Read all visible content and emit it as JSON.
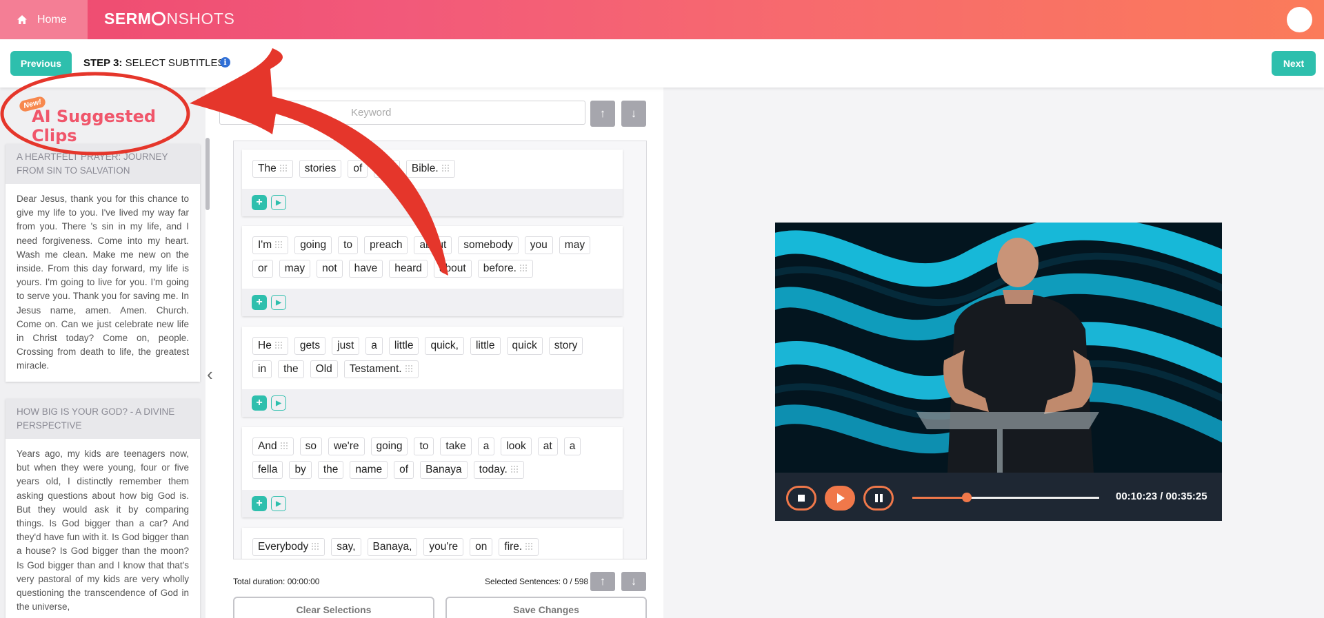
{
  "header": {
    "home_label": "Home",
    "logo_text_left": "SERM",
    "logo_text_right": "NSHOTS"
  },
  "stepbar": {
    "previous_label": "Previous",
    "next_label": "Next",
    "step_prefix": "STEP 3:",
    "step_title": "SELECT SUBTITLES",
    "info_glyph": "i"
  },
  "ai_panel": {
    "badge": "New!",
    "title": "AI Suggested Clips",
    "clips": [
      {
        "title": "A HEARTFELT PRAYER: JOURNEY FROM SIN TO SALVATION",
        "body": "Dear Jesus, thank you for this chance to give my life to you. I've lived my way far from you. There 's sin in my life, and I need forgiveness. Come into my heart. Wash me clean. Make me new on the inside. From this day forward, my life is yours. I'm going to live for you. I'm going to serve you. Thank you for saving me. In Jesus name, amen. Amen. Church. Come on. Can we just celebrate new life in Christ today? Come on, people. Crossing from death to life, the greatest miracle."
      },
      {
        "title": "HOW BIG IS YOUR GOD? - A DIVINE PERSPECTIVE",
        "body": "Years ago, my kids are teenagers now, but when they were young, four or five years old, I distinctly remember them asking questions about how big God is. But they would ask it by comparing things. Is God bigger than a car? And they'd have fun with it. Is God bigger than a house? Is God bigger than the moon? Is God bigger than and I know that that's very pastoral of my kids are very wholly questioning the transcendence of God in the universe,"
      }
    ]
  },
  "search": {
    "placeholder": "Keyword"
  },
  "subtitles": [
    {
      "words": [
        "The",
        "stories",
        "of",
        "the",
        "Bible."
      ]
    },
    {
      "words": [
        "I'm",
        "going",
        "to",
        "preach",
        "about",
        "somebody",
        "you",
        "may",
        "or",
        "may",
        "not",
        "have",
        "heard",
        "about",
        "before."
      ]
    },
    {
      "words": [
        "He",
        "gets",
        "just",
        "a",
        "little",
        "quick,",
        "little",
        "quick",
        "story",
        "in",
        "the",
        "Old",
        "Testament."
      ]
    },
    {
      "words": [
        "And",
        "so",
        "we're",
        "going",
        "to",
        "take",
        "a",
        "look",
        "at",
        "a",
        "fella",
        "by",
        "the",
        "name",
        "of",
        "Banaya",
        "today."
      ]
    },
    {
      "words": [
        "Everybody",
        "say,",
        "Banaya,",
        "you're",
        "on",
        "fire."
      ]
    }
  ],
  "footer": {
    "total_duration": "Total duration: 00:00:00",
    "selected": "Selected Sentences: 0 / 598",
    "clear_label": "Clear Selections",
    "save_label": "Save Changes"
  },
  "player": {
    "time": "00:10:23 / 00:35:25",
    "progress": 0.29
  },
  "colors": {
    "accent_teal": "#2ebfad",
    "brand_pink": "#ee4a6f",
    "player_orange": "#f0784a",
    "annotation_red": "#e5362b"
  }
}
